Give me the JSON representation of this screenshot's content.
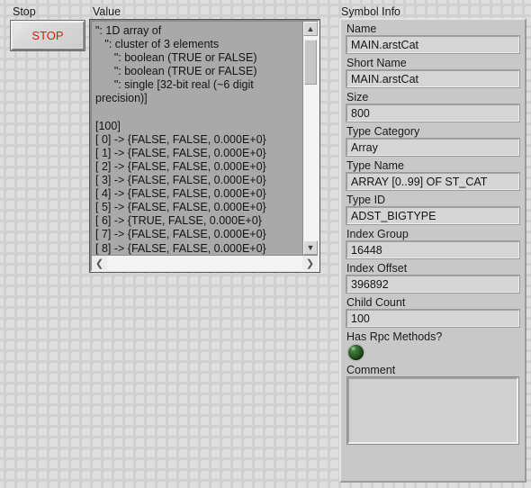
{
  "stop": {
    "caption": "Stop",
    "button_label": "STOP",
    "label_color": "#e8120c"
  },
  "value": {
    "caption": "Value",
    "text": "\": 1D array of\n   \": cluster of 3 elements\n      \": boolean (TRUE or FALSE)\n      \": boolean (TRUE or FALSE)\n      \": single [32-bit real (~6 digit\nprecision)]\n\n[100]\n[ 0] -> {FALSE, FALSE, 0.000E+0}\n[ 1] -> {FALSE, FALSE, 0.000E+0}\n[ 2] -> {FALSE, FALSE, 0.000E+0}\n[ 3] -> {FALSE, FALSE, 0.000E+0}\n[ 4] -> {FALSE, FALSE, 0.000E+0}\n[ 5] -> {FALSE, FALSE, 0.000E+0}\n[ 6] -> {TRUE, FALSE, 0.000E+0}\n[ 7] -> {FALSE, FALSE, 0.000E+0}\n[ 8] -> {FALSE, FALSE, 0.000E+0}",
    "scroll_up_icon": "▲",
    "scroll_down_icon": "▼",
    "scroll_left_icon": "❮",
    "scroll_right_icon": "❯"
  },
  "symbol_info": {
    "caption": "Symbol Info",
    "fields": [
      {
        "label": "Name",
        "value": "MAIN.arstCat"
      },
      {
        "label": "Short Name",
        "value": "MAIN.arstCat"
      },
      {
        "label": "Size",
        "value": "800"
      },
      {
        "label": "Type Category",
        "value": "Array"
      },
      {
        "label": "Type Name",
        "value": "ARRAY [0..99] OF ST_CAT"
      },
      {
        "label": "Type ID",
        "value": "ADST_BIGTYPE"
      },
      {
        "label": "Index Group",
        "value": "16448"
      },
      {
        "label": "Index Offset",
        "value": "396892"
      },
      {
        "label": "Child Count",
        "value": "100"
      }
    ],
    "has_rpc_methods": {
      "label": "Has Rpc Methods?",
      "state": "off",
      "color": "#2a5c24"
    },
    "comment": {
      "label": "Comment",
      "value": ""
    }
  }
}
